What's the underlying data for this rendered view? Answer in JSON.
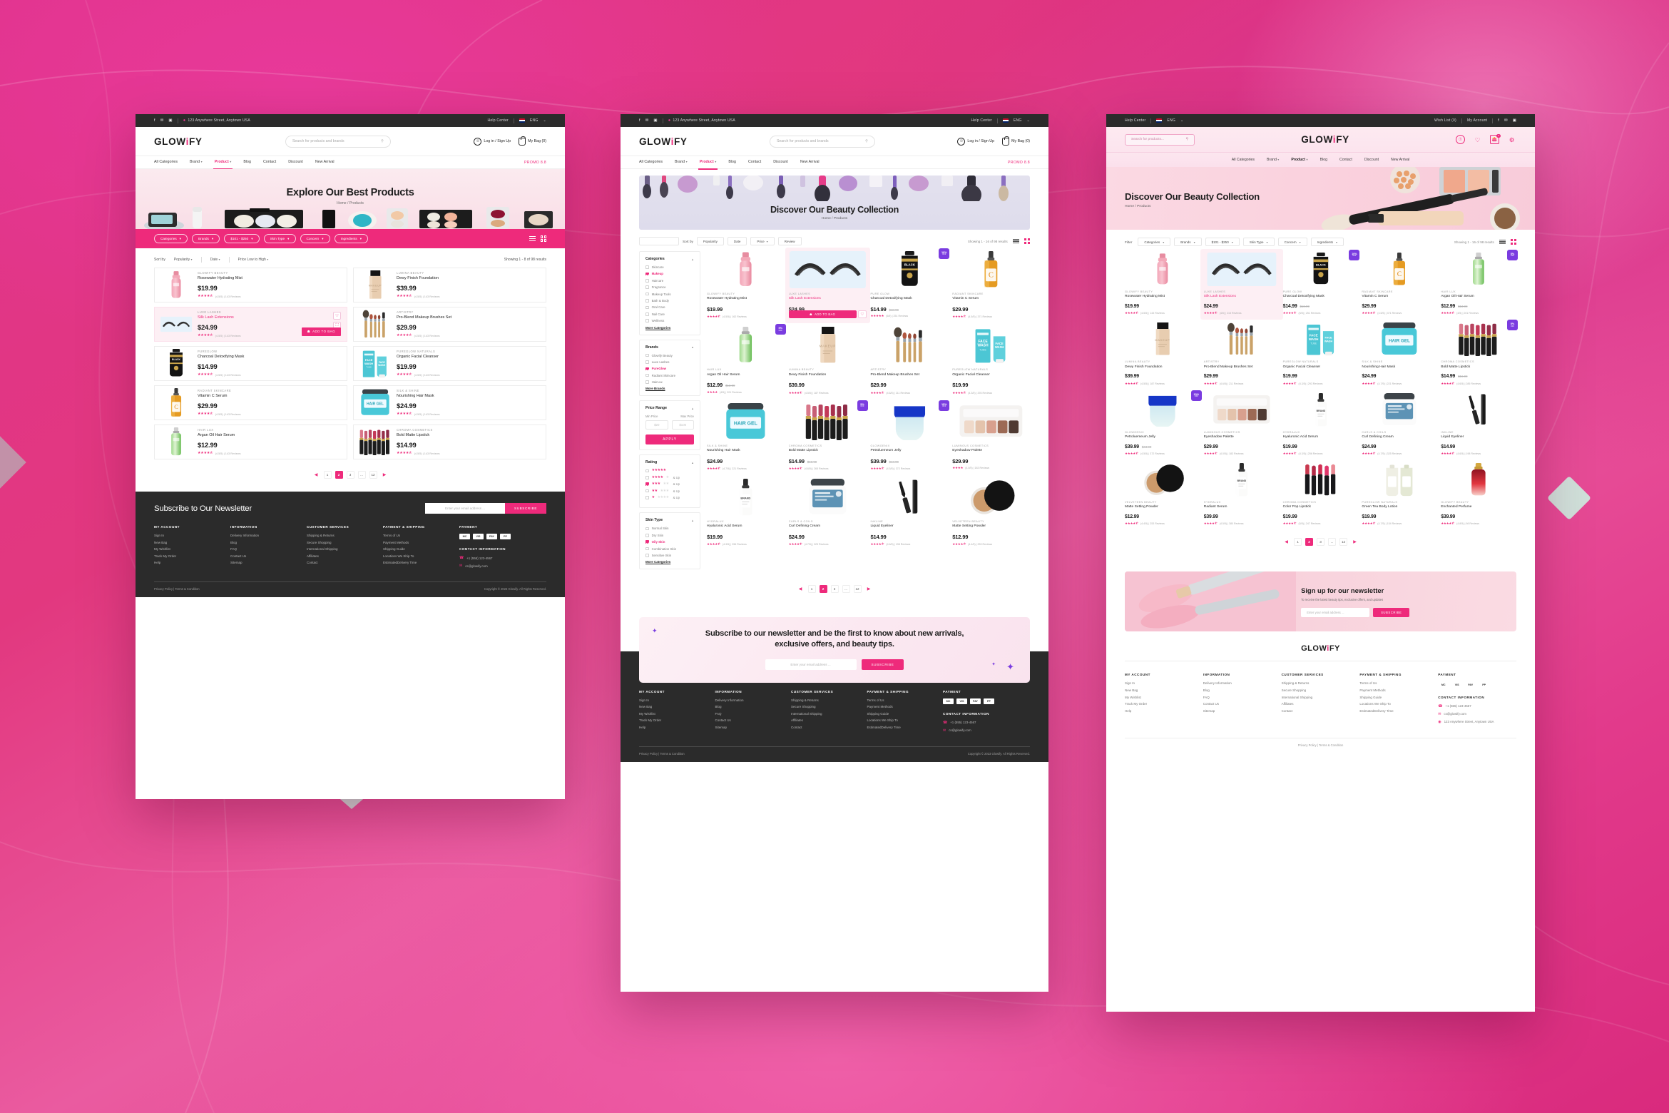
{
  "brand": {
    "name_a": "GLOW",
    "name_i": "i",
    "name_b": "FY"
  },
  "topbar": {
    "address": "123 Anywhere Street, Anytown USA",
    "help": "Help Center",
    "lang": "ENG",
    "wishlist": "Wish List (0)",
    "account": "My Account",
    "facebook": "f",
    "twitter": "✉",
    "instagram": "▣",
    "chevron": "⌄"
  },
  "header": {
    "search_placeholder": "Search for products and brands",
    "search_placeholder_short": "Search for products...",
    "login": "Log in / Sign Up",
    "bag": "My Bag (0)",
    "bag_count": "0"
  },
  "nav": {
    "items": [
      {
        "label": "All Categories",
        "active": false,
        "caret": false
      },
      {
        "label": "Brand",
        "active": false,
        "caret": true
      },
      {
        "label": "Product",
        "active": true,
        "caret": true
      },
      {
        "label": "Blog",
        "active": false,
        "caret": false
      },
      {
        "label": "Contact",
        "active": false,
        "caret": false
      },
      {
        "label": "Discount",
        "active": false,
        "caret": false
      },
      {
        "label": "New Arrival",
        "active": false,
        "caret": false
      }
    ],
    "promo": "PROMO 8.8"
  },
  "hero1": {
    "title": "Explore Our Best Products",
    "crumb": "Home / Products"
  },
  "hero2": {
    "title": "Discover Our Beauty Collection",
    "crumb": "Home / Products"
  },
  "hero3": {
    "title": "Discover Our Beauty Collection",
    "crumb": "Home / Products"
  },
  "filterbar": {
    "label": "Filter",
    "chips": [
      "Categories",
      "Brands",
      "$101 - $250",
      "Skin Type",
      "Concern",
      "Ingredients"
    ]
  },
  "sortrow": {
    "sort_by": "Sort by",
    "options": [
      "Popularity",
      "Date",
      "Price Low to High"
    ],
    "results": "Showing 1 - 8 of 98 results"
  },
  "sortrow2": {
    "sort_by": "Sort by",
    "pills": [
      "Popularity",
      "Date",
      "Price",
      "Review"
    ],
    "results": "Showing 1 - 16 of 98 results"
  },
  "results3": "Showing 1 - 16 of 98 results",
  "filters": [
    {
      "title": "Categories",
      "options": [
        {
          "label": "Skincare",
          "on": false
        },
        {
          "label": "Makeup",
          "on": true
        },
        {
          "label": "Haircare",
          "on": false
        },
        {
          "label": "Fragrance",
          "on": false
        },
        {
          "label": "Makeup Tools",
          "on": false
        },
        {
          "label": "Bath & Body",
          "on": false
        },
        {
          "label": "Oral Care",
          "on": false
        },
        {
          "label": "Nail Care",
          "on": false
        },
        {
          "label": "Wellness",
          "on": false
        }
      ],
      "more": "More Categories"
    },
    {
      "title": "Brands",
      "options": [
        {
          "label": "Glowify Beauty",
          "on": false
        },
        {
          "label": "Luxe Lashes",
          "on": false
        },
        {
          "label": "PureGlow",
          "on": true
        },
        {
          "label": "Radiant Skincare",
          "on": false
        },
        {
          "label": "HairLux",
          "on": false
        }
      ],
      "more": "More Brands"
    }
  ],
  "price_filter": {
    "title": "Price Range",
    "min_label": "Min Price",
    "max_label": "Max Price",
    "min_placeholder": "$20",
    "max_placeholder": "$100",
    "apply": "APPLY"
  },
  "rating_filter": {
    "title": "Rating",
    "rows": [
      {
        "stars": 5,
        "on": false,
        "suffix": ""
      },
      {
        "stars": 4,
        "on": false,
        "suffix": "& Up"
      },
      {
        "stars": 3,
        "on": true,
        "suffix": "& Up"
      },
      {
        "stars": 2,
        "on": false,
        "suffix": "& Up"
      },
      {
        "stars": 1,
        "on": false,
        "suffix": "& Up"
      }
    ]
  },
  "skin_filter": {
    "title": "Skin Type",
    "options": [
      {
        "label": "Normal Skin",
        "on": false
      },
      {
        "label": "Dry Skin",
        "on": false
      },
      {
        "label": "Oily Skin",
        "on": true
      },
      {
        "label": "Combination Skin",
        "on": false
      },
      {
        "label": "Sensitive Skin",
        "on": false
      }
    ],
    "more": "More Categories"
  },
  "list_products": [
    {
      "brand": "GLOWIFY BEAUTY",
      "name": "Rosewater Hydrating Mist",
      "price": "$19.99",
      "rating": "(4.5/5) | 143 Reviews",
      "hl": false,
      "art": "mist"
    },
    {
      "brand": "LUMINA BEAUTY",
      "name": "Dewy Finish Foundation",
      "price": "$39.99",
      "rating": "(4.5/5) | 143 Reviews",
      "hl": false,
      "art": "foundation"
    },
    {
      "brand": "LUXE LASHES",
      "name": "Silk Lash Extensions",
      "price": "$24.99",
      "rating": "(4.5/5) | 143 Reviews",
      "hl": true,
      "art": "lash"
    },
    {
      "brand": "ARTISTRY",
      "name": "Pro-Blend Makeup Brushes Set",
      "price": "$29.99",
      "rating": "(4.5/5) | 143 Reviews",
      "hl": false,
      "art": "brushes"
    },
    {
      "brand": "PUREGLOW",
      "name": "Charcoal Detoxifying Mask",
      "price": "$14.99",
      "rating": "(4.5/5) | 143 Reviews",
      "hl": false,
      "art": "blackmask"
    },
    {
      "brand": "PUREGLOW NATURALS",
      "name": "Organic Facial Cleanser",
      "price": "$19.99",
      "rating": "(4.5/5) | 143 Reviews",
      "hl": false,
      "art": "facewash"
    },
    {
      "brand": "RADIANT SKINCARE",
      "name": "Vitamin C Serum",
      "price": "$29.99",
      "rating": "(4.5/5) | 143 Reviews",
      "hl": false,
      "art": "vitc"
    },
    {
      "brand": "SILK & SHINE",
      "name": "Nourishing Hair Mask",
      "price": "$24.99",
      "rating": "(4.5/5) | 143 Reviews",
      "hl": false,
      "art": "hairgel"
    },
    {
      "brand": "HAIR LUX",
      "name": "Argan Oil Hair Serum",
      "price": "$12.99",
      "rating": "(4.5/5) | 143 Reviews",
      "hl": false,
      "art": "argan"
    },
    {
      "brand": "CHROMA COSMETICS",
      "name": "Bold Matte Lipstick",
      "price": "$14.99",
      "rating": "(4.5/5) | 143 Reviews",
      "hl": false,
      "art": "lipsticks"
    }
  ],
  "list_actions": {
    "add_to_bag": "ADD TO BAG",
    "heart": "♡",
    "expand": "⛶"
  },
  "grid_products": [
    {
      "brand": "GLOWIFY BEAUTY",
      "name": "Rosewater Hydrating Mist",
      "price": "$19.99",
      "old": "",
      "rating": "(4.5/5) | 162 Reviews",
      "stars": 4.5,
      "badge": "",
      "hl": false,
      "art": "mist"
    },
    {
      "brand": "LUXE LASHES",
      "name": "Silk Lash Extensions",
      "price": "$24.99",
      "old": "",
      "rating": "(4/5) | 215 Reviews",
      "stars": 4,
      "badge": "",
      "hl": true,
      "art": "lash"
    },
    {
      "brand": "PURE GLOW",
      "name": "Charcoal Detoxifying Mask",
      "price": "$14.99",
      "old": "$18.99",
      "rating": "(5/5) | 251 Reviews",
      "stars": 5,
      "badge": "10%",
      "hl": false,
      "art": "blackmask"
    },
    {
      "brand": "RADIANT SKINCARE",
      "name": "Vitamin C Serum",
      "price": "$29.99",
      "old": "",
      "rating": "(4.5/5) | 371 Reviews",
      "stars": 4.5,
      "badge": "",
      "hl": false,
      "art": "vitc"
    },
    {
      "brand": "HAIR LUX",
      "name": "Argan Oil Hair Serum",
      "price": "$12.99",
      "old": "$13.99",
      "rating": "(4/5) | 201 Reviews",
      "stars": 4,
      "badge": "5%",
      "hl": false,
      "art": "argan"
    },
    {
      "brand": "LUMINA BEAUTY",
      "name": "Dewy Finish Foundation",
      "price": "$39.99",
      "old": "",
      "rating": "(4.5/5) | 187 Reviews",
      "stars": 4.5,
      "badge": "",
      "hl": false,
      "art": "foundation"
    },
    {
      "brand": "ARTISTRY",
      "name": "Pro-Blend Makeup Brushes Set",
      "price": "$29.99",
      "old": "",
      "rating": "(4.6/5) | 211 Reviews",
      "stars": 4.5,
      "badge": "",
      "hl": false,
      "art": "brushes"
    },
    {
      "brand": "PUREGLOW NATURALS",
      "name": "Organic Facial Cleanser",
      "price": "$19.99",
      "old": "",
      "rating": "(4.3/5) | 293 Reviews",
      "stars": 4.5,
      "badge": "",
      "hl": false,
      "art": "facewash"
    },
    {
      "brand": "SILK & SHINE",
      "name": "Nourishing Hair Mask",
      "price": "$24.99",
      "old": "",
      "rating": "(4.7/5) | 221 Reviews",
      "stars": 4.5,
      "badge": "",
      "hl": false,
      "art": "hairgel"
    },
    {
      "brand": "CHROMA COSMETICS",
      "name": "Bold Matte Lipstick",
      "price": "$14.99",
      "old": "$16.99",
      "rating": "(4.6/5) | 265 Reviews",
      "stars": 4.5,
      "badge": "5%",
      "hl": false,
      "art": "lipsticks"
    },
    {
      "brand": "GLOWGENIX",
      "name": "Petroluemeum Jelly",
      "price": "$39.99",
      "old": "$44.99",
      "rating": "(4.5/5) | 372 Reviews",
      "stars": 4.5,
      "badge": "15%",
      "hl": false,
      "art": "jelly"
    },
    {
      "brand": "LUMINOUS COSMETICS",
      "name": "Eyeshadow Palette",
      "price": "$29.99",
      "old": "",
      "rating": "(4.0/5) | 183 Reviews",
      "stars": 4,
      "badge": "",
      "hl": false,
      "art": "palette"
    },
    {
      "brand": "HYDRALUX",
      "name": "Hyaluronic Acid Serum",
      "price": "$19.99",
      "old": "",
      "rating": "(4.3/5) | 256 Reviews",
      "stars": 4.5,
      "badge": "",
      "hl": false,
      "art": "whiteserum"
    },
    {
      "brand": "CURLS & COILS",
      "name": "Curl Defining Cream",
      "price": "$24.99",
      "old": "",
      "rating": "(4.7/5) | 325 Reviews",
      "stars": 4.5,
      "badge": "",
      "hl": false,
      "art": "cream"
    },
    {
      "brand": "INKLINE",
      "name": "Liquid Eyeliner",
      "price": "$14.99",
      "old": "",
      "rating": "(4.6/5) | 198 Reviews",
      "stars": 4.5,
      "badge": "",
      "hl": false,
      "art": "eyeliner"
    },
    {
      "brand": "VELVETEEN BEAUTY",
      "name": "Matte Setting Powder",
      "price": "$12.99",
      "old": "",
      "rating": "(4.4/5) | 253 Reviews",
      "stars": 4.5,
      "badge": "",
      "hl": false,
      "art": "powder"
    }
  ],
  "grid3_products": [
    {
      "brand": "GLOWIFY BEAUTY",
      "name": "Rosewater Hydrating Mist",
      "price": "$19.99",
      "old": "",
      "rating": "(4.5/5) | 143 Reviews",
      "badge": "",
      "hl": false,
      "art": "mist"
    },
    {
      "brand": "LUXE LASHES",
      "name": "Silk Lash Extensions",
      "price": "$24.99",
      "old": "",
      "rating": "(4/5) | 215 Reviews",
      "badge": "",
      "hl": true,
      "art": "lash"
    },
    {
      "brand": "PURE GLOW",
      "name": "Charcoal Detoxifying Mask",
      "price": "$14.99",
      "old": "$18.99",
      "rating": "(5/5) | 251 Reviews",
      "badge": "10%",
      "hl": false,
      "art": "blackmask"
    },
    {
      "brand": "RADIANT SKINCARE",
      "name": "Vitamin C Serum",
      "price": "$29.99",
      "old": "",
      "rating": "(4.5/5) | 371 Reviews",
      "badge": "",
      "hl": false,
      "art": "vitc"
    },
    {
      "brand": "HAIR LUX",
      "name": "Argan Oil Hair Serum",
      "price": "$12.99",
      "old": "$13.99",
      "rating": "(4/5) | 201 Reviews",
      "badge": "5%",
      "hl": false,
      "art": "argan"
    },
    {
      "brand": "LUMINA BEAUTY",
      "name": "Dewy Finish Foundation",
      "price": "$39.99",
      "old": "",
      "rating": "(4.5/5) | 187 Reviews",
      "badge": "",
      "hl": false,
      "art": "foundation"
    },
    {
      "brand": "ARTISTRY",
      "name": "Pro-Blend Makeup Brushes Set",
      "price": "$29.99",
      "old": "",
      "rating": "(4.6/5) | 211 Reviews",
      "badge": "",
      "hl": false,
      "art": "brushes"
    },
    {
      "brand": "PUREGLOW NATURALS",
      "name": "Organic Facial Cleanser",
      "price": "$19.99",
      "old": "",
      "rating": "(4.3/5) | 293 Reviews",
      "badge": "",
      "hl": false,
      "art": "facewash"
    },
    {
      "brand": "SILK & SHINE",
      "name": "Nourishing Hair Mask",
      "price": "$24.99",
      "old": "",
      "rating": "(4.7/5) | 221 Reviews",
      "badge": "",
      "hl": false,
      "art": "hairgel"
    },
    {
      "brand": "CHROMA COSMETICS",
      "name": "Bold Matte Lipstick",
      "price": "$14.99",
      "old": "$16.99",
      "rating": "(4.6/5) | 285 Reviews",
      "badge": "5%",
      "hl": false,
      "art": "lipsticks"
    },
    {
      "brand": "GLOWGENIX",
      "name": "Petroluemeum Jelly",
      "price": "$39.99",
      "old": "$44.99",
      "rating": "(4.5/5) | 372 Reviews",
      "badge": "15%",
      "hl": false,
      "art": "jelly"
    },
    {
      "brand": "LUMINOUS COSMETICS",
      "name": "Eyeshadow Palette",
      "price": "$29.99",
      "old": "",
      "rating": "(4.0/5) | 183 Reviews",
      "badge": "",
      "hl": false,
      "art": "palette"
    },
    {
      "brand": "HYDRALUX",
      "name": "Hyaluronic Acid Serum",
      "price": "$19.99",
      "old": "",
      "rating": "(4.3/5) | 256 Reviews",
      "badge": "",
      "hl": false,
      "art": "whiteserum"
    },
    {
      "brand": "CURLS & COILS",
      "name": "Curl Defining Cream",
      "price": "$24.99",
      "old": "",
      "rating": "(4.7/5) | 325 Reviews",
      "badge": "",
      "hl": false,
      "art": "cream"
    },
    {
      "brand": "INKLINE",
      "name": "Liquid Eyeliner",
      "price": "$14.99",
      "old": "",
      "rating": "(4.6/5) | 198 Reviews",
      "badge": "",
      "hl": false,
      "art": "eyeliner"
    },
    {
      "brand": "VELVETEEN BEAUTY",
      "name": "Matte Setting Powder",
      "price": "$12.99",
      "old": "",
      "rating": "(4.4/5) | 253 Reviews",
      "badge": "",
      "hl": false,
      "art": "powder"
    },
    {
      "brand": "HYDRALUX",
      "name": "Radiant Serum",
      "price": "$39.99",
      "old": "",
      "rating": "(4.5/5) | 380 Reviews",
      "badge": "",
      "hl": false,
      "art": "whiteserum"
    },
    {
      "brand": "CHROMA COSMETICS",
      "name": "Color Pop Lipstick",
      "price": "$19.99",
      "old": "",
      "rating": "(5/5) | 247 Reviews",
      "badge": "",
      "hl": false,
      "art": "lipsticks2"
    },
    {
      "brand": "PUREGLOW NATURALS",
      "name": "Green Tea Body Lotion",
      "price": "$19.99",
      "old": "",
      "rating": "(4.7/5) | 154 Reviews",
      "badge": "",
      "hl": false,
      "art": "lotion"
    },
    {
      "brand": "GLOWIFY BEAUTY",
      "name": "Enchanted Perfume",
      "price": "$39.99",
      "old": "",
      "rating": "(4.8/5) | 98 Reviews",
      "badge": "",
      "hl": false,
      "art": "perfume"
    }
  ],
  "pagination": {
    "pages": [
      "1",
      "2",
      "3",
      "...",
      "12"
    ],
    "current": "2",
    "prev": "◀",
    "next": "▶"
  },
  "newsletter1": {
    "title": "Subscribe to Our Newsletter",
    "placeholder": "Enter your email address ...",
    "button": "SUBSCRIBE"
  },
  "newsletter2": {
    "title": "Subscribe to our newsletter and be the first to know about new arrivals, exclusive offers, and beauty tips.",
    "placeholder": "Enter your email address ...",
    "button": "SUBSCRIBE"
  },
  "newsletter3": {
    "title": "Sign up for our newsletter",
    "subtitle": "To receive the latest beauty tips, exclusive offers, and updates",
    "placeholder": "Enter your email address ...",
    "button": "SUBSCRIBE"
  },
  "footer": {
    "columns": [
      {
        "head": "MY ACCOUNT",
        "links": [
          "Sign In",
          "New Bag",
          "My Wishlist",
          "Track My Order",
          "Help"
        ]
      },
      {
        "head": "INFORMATION",
        "links": [
          "Delivery Information",
          "Blog",
          "FAQ",
          "Contact Us",
          "Sitemap"
        ]
      },
      {
        "head": "CUSTOMER SERVICES",
        "links": [
          "Shipping & Returns",
          "Secure Shopping",
          "International Shipping",
          "Affiliates",
          "Contact"
        ]
      },
      {
        "head": "PAYMENT & SHIPPING",
        "links": [
          "Terms of Us",
          "Payment Methods",
          "Shipping Guide",
          "Locations We Ship To",
          "EstimatedDelivery Time"
        ]
      }
    ],
    "payment_head": "PAYMENT",
    "payment_chips": [
      "MC",
      "VIS",
      "PAY",
      "PP"
    ],
    "contact_head": "CONTACT INFORMATION",
    "phone": "+1 (555) 123-4567",
    "email": "cs@glowify.com",
    "phone_icon": "☎",
    "email_icon": "✉",
    "pin_icon": "◉",
    "address": "123 Anywhere Street, Anytown USA",
    "privacy": "Privacy Policy  |  Terms & Condition",
    "copyright": "Copyright © 2023 Glowify. All Rights Reserved."
  },
  "footer3": {
    "contact_head": "CONTACT INFORMATION",
    "bottom": "Privacy Policy  |  Terms & Condition"
  }
}
